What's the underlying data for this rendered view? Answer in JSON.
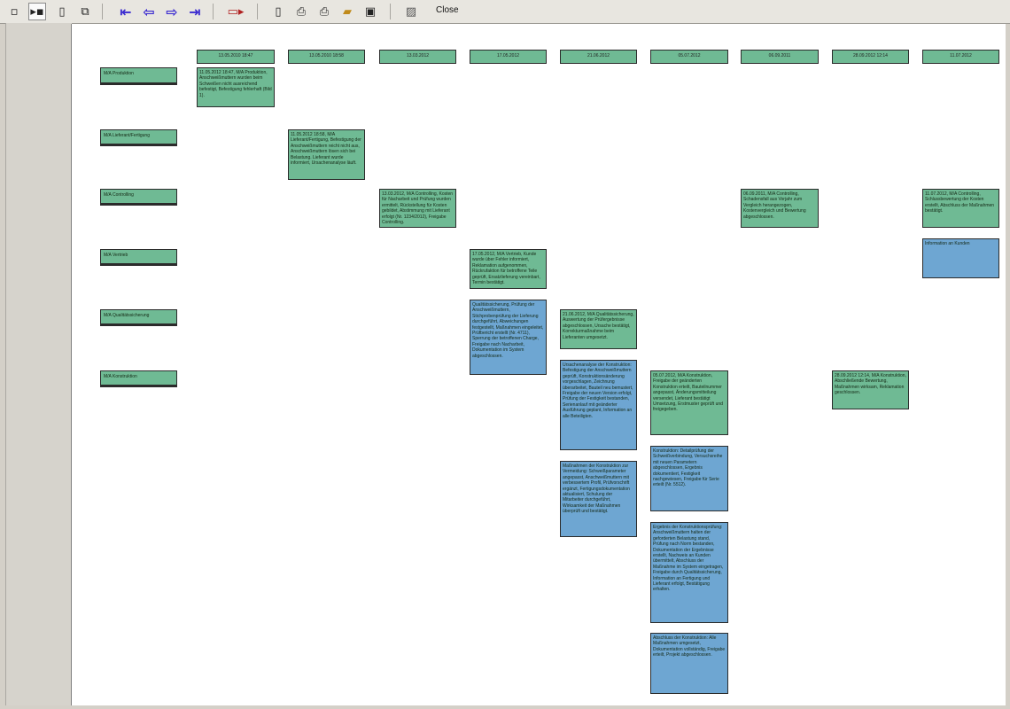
{
  "toolbar": {
    "close_label": "Close"
  },
  "columns": [
    {
      "label": "13.05.2010 18:47"
    },
    {
      "label": "13.05.2010 18:58"
    },
    {
      "label": "13.03.2012"
    },
    {
      "label": "17.05.2012"
    },
    {
      "label": "21.06.2012"
    },
    {
      "label": "05.07.2012"
    },
    {
      "label": "06.09.2011"
    },
    {
      "label": "28.09.2012 12:14"
    },
    {
      "label": "11.07.2012"
    }
  ],
  "rows": [
    {
      "label": "M/A Produktion"
    },
    {
      "label": "M/A Lieferant/Fertigung"
    },
    {
      "label": "M/A Controlling"
    },
    {
      "label": "M/A Vertrieb"
    },
    {
      "label": "M/A Qualitätssicherung"
    },
    {
      "label": "M/A Konstruktion"
    }
  ],
  "cards": [
    {
      "color": "green",
      "text": "11.05.2012 18:47, M/A Produktion, Anschweißmuttern wurden beim Schweißen nicht ausreichend befestigt, Befestigung fehlerhaft (Bild 1)."
    },
    {
      "color": "green",
      "text": "11.05.2012 18:58, M/A Lieferant/Fertigung, Befestigung der Anschweißmuttern reicht nicht aus, Anschweißmuttern lösen sich bei Belastung. Lieferant wurde informiert, Ursachenanalyse läuft."
    },
    {
      "color": "green",
      "text": "13.03.2012, M/A Controlling, Kosten für Nacharbeit und Prüfung wurden ermittelt, Rückstellung für Kosten gebildet, Abstimmung mit Lieferant erfolgt (Nr. 1234/2012), Freigabe Controlling."
    },
    {
      "color": "green",
      "text": "06.09.2011, M/A Controlling, Schadensfall aus Vorjahr zum Vergleich herangezogen, Kostenvergleich und Bewertung abgeschlossen."
    },
    {
      "color": "green",
      "text": "11.07.2012, M/A Controlling, Schlussbewertung der Kosten erstellt, Abschluss der Maßnahmen bestätigt."
    },
    {
      "color": "green",
      "text": "17.05.2012, M/A Vertrieb, Kunde wurde über Fehler informiert, Reklamation aufgenommen, Rückrufaktion für betroffene Teile geprüft, Ersatzlieferung vereinbart, Termin bestätigt."
    },
    {
      "color": "blue",
      "text": "Information an Kunden"
    },
    {
      "color": "blue",
      "text": "Qualitätssicherung, Prüfung der Anschweißmuttern, Stichprobenprüfung der Lieferung durchgeführt, Abweichungen festgestellt, Maßnahmen eingeleitet, Prüfbericht erstellt (Nr. 4711), Sperrung der betroffenen Charge, Freigabe nach Nacharbeit, Dokumentation im System abgeschlossen."
    },
    {
      "color": "green",
      "text": "21.06.2012, M/A Qualitätssicherung, Auswertung der Prüfergebnisse abgeschlossen, Ursache bestätigt, Korrekturmaßnahme beim Lieferanten umgesetzt."
    },
    {
      "color": "blue",
      "text": "Ursachenanalyse der Konstruktion: Befestigung der Anschweißmuttern geprüft, Konstruktionsänderung vorgeschlagen, Zeichnung überarbeitet, Bauteil neu bemustert, Freigabe der neuen Version erfolgt, Prüfung der Festigkeit bestanden, Serienanlauf mit geänderter Ausführung geplant, Information an alle Beteiligten."
    },
    {
      "color": "blue",
      "text": "Maßnahmen der Konstruktion zur Vermeidung: Schweißparameter angepasst, Anschweißmuttern mit verbessertem Profil, Prüfvorschrift ergänzt, Fertigungsdokumentation aktualisiert, Schulung der Mitarbeiter durchgeführt, Wirksamkeit der Maßnahmen überprüft und bestätigt."
    },
    {
      "color": "green",
      "text": "05.07.2012, M/A Konstruktion, Freigabe der geänderten Konstruktion erteilt, Bauteilnummer angepasst, Änderungsmitteilung versendet, Lieferant bestätigt Umsetzung, Erstmuster geprüft und freigegeben."
    },
    {
      "color": "blue",
      "text": "Konstruktion: Detailprüfung der Schweißverbindung, Versuchsreihe mit neuen Parametern abgeschlossen, Ergebnis dokumentiert, Festigkeit nachgewiesen, Freigabe für Serie erteilt (Nr. 5512)."
    },
    {
      "color": "blue",
      "text": "Ergebnis der Konstruktionsprüfung: Anschweißmuttern halten der geforderten Belastung stand, Prüfung nach Norm bestanden, Dokumentation der Ergebnisse erstellt, Nachweis an Kunden übermittelt, Abschluss der Maßnahme im System eingetragen, Freigabe durch Qualitätssicherung, Information an Fertigung und Lieferant erfolgt, Bestätigung erhalten."
    },
    {
      "color": "blue",
      "text": "Abschluss der Konstruktion: Alle Maßnahmen umgesetzt, Dokumentation vollständig, Freigabe erteilt, Projekt abgeschlossen."
    },
    {
      "color": "green",
      "text": "28.09.2012 12:14, M/A Konstruktion, Abschließende Bewertung, Maßnahmen wirksam, Reklamation geschlossen."
    }
  ]
}
